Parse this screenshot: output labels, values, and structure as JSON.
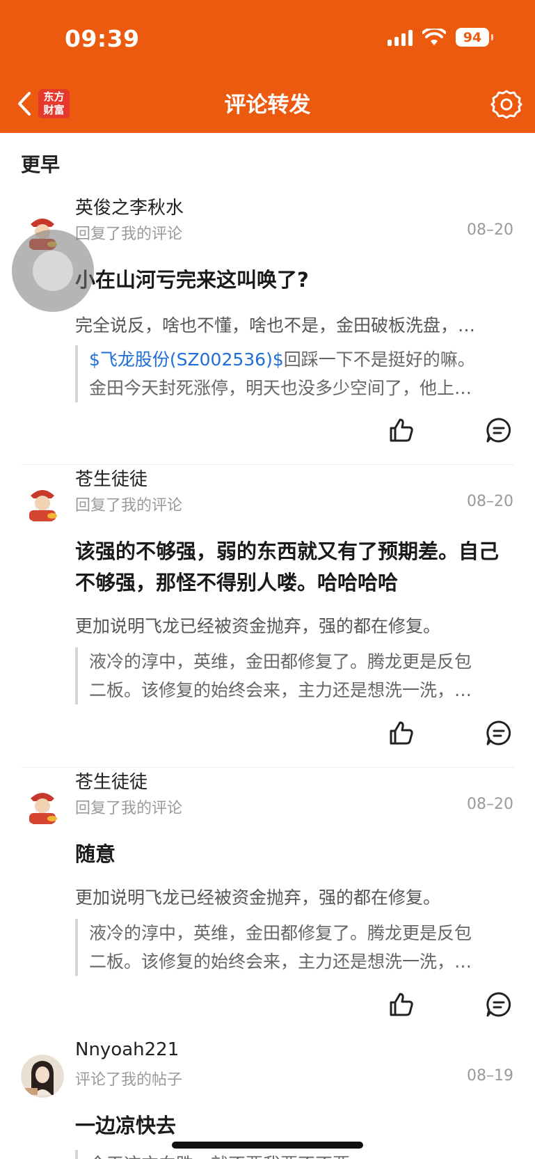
{
  "status_bar": {
    "time": "09:39",
    "battery": "94"
  },
  "nav": {
    "title": "评论转发",
    "logo_text": "东方\n财富"
  },
  "section_title": "更早",
  "items": [
    {
      "username": "英俊之李秋水",
      "action": "回复了我的评论",
      "date": "08–20",
      "reply": "小在山河亏完来这叫唤了?",
      "my_comment": "完全说反，啥也不懂，啥也不是，金田破板洗盘，…",
      "quote_link": "$飞龙股份(SZ002536)$",
      "quote_line1": "回踩一下不是挺好的嘛。",
      "quote_line2": "金田今天封死涨停，明天也没多少空间了，他上…"
    },
    {
      "username": "苍生徒徒",
      "action": "回复了我的评论",
      "date": "08–20",
      "reply": "该强的不够强，弱的东西就又有了预期差。自己不够强，那怪不得别人喽。哈哈哈哈",
      "my_comment": "更加说明飞龙已经被资金抛弃，强的都在修复。",
      "quote_line1": "液冷的淳中，英维，金田都修复了。腾龙更是反包",
      "quote_line2": "二板。该修复的始终会来，主力还是想洗一洗，…"
    },
    {
      "username": "苍生徒徒",
      "action": "回复了我的评论",
      "date": "08–20",
      "reply": "随意",
      "my_comment": "更加说明飞龙已经被资金抛弃，强的都在修复。",
      "quote_line1": "液冷的淳中，英维，金田都修复了。腾龙更是反包",
      "quote_line2": "二板。该修复的始终会来，主力还是想洗一洗，…"
    },
    {
      "username": "Nnyoah221",
      "action": "评论了我的帖子",
      "date": "08–19",
      "reply": "一边凉快去",
      "quote_line1": "今天这方向跌，就不要我要不不要"
    }
  ],
  "colors": {
    "header": "#eb5a0e",
    "link": "#1e6fd9",
    "secondary_text": "#9a9a9a"
  },
  "icons": [
    "back-icon",
    "gear-icon",
    "thumbs-up-icon",
    "comment-icon"
  ]
}
